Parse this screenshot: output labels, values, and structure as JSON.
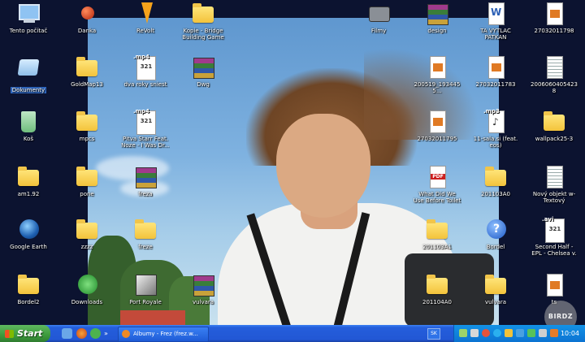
{
  "desktop": {
    "icons": [
      {
        "label": "Tento počítač",
        "type": "computer"
      },
      {
        "label": "Danka",
        "type": "ball"
      },
      {
        "label": "ReVolt",
        "type": "shortcut-bolt"
      },
      {
        "label": "Kopie - Bridge Building Game",
        "type": "folder"
      },
      {
        "label": "Filmy",
        "type": "camera"
      },
      {
        "label": "design",
        "type": "rar"
      },
      {
        "label": "TA VYTLAČ PATKAN",
        "type": "word"
      },
      {
        "label": "27032011798",
        "type": "image"
      },
      {
        "label": "Dokumenty",
        "type": "mydocs",
        "selected": true
      },
      {
        "label": "GoldMap13",
        "type": "folder"
      },
      {
        "label": "dva roky sniest",
        "type": "mp4",
        "tag": ".mp4"
      },
      {
        "label": "Dwg",
        "type": "rar"
      },
      {
        "label": "200519_1934455...",
        "type": "image"
      },
      {
        "label": "27032011783",
        "type": "image"
      },
      {
        "label": "20060604054238",
        "type": "image-lines"
      },
      {
        "label": "Koš",
        "type": "recycle"
      },
      {
        "label": "mpcs",
        "type": "folder"
      },
      {
        "label": "Pitva Starr Feat. Noze - I Was Dr...",
        "type": "mp4",
        "tag": ".mp4"
      },
      {
        "label": "27032011795",
        "type": "image"
      },
      {
        "label": "11-sala.si (feat. eos)",
        "type": "mp3",
        "tag": ".mp3"
      },
      {
        "label": "wallpack25-3",
        "type": "folder"
      },
      {
        "label": "am1.92",
        "type": "folder"
      },
      {
        "label": "pone",
        "type": "folder"
      },
      {
        "label": "freza",
        "type": "rar"
      },
      {
        "label": "What Did We Use Before Toilet Paper",
        "type": "pdf"
      },
      {
        "label": "201103A0",
        "type": "folder"
      },
      {
        "label": "Nový objekt w-Textový dokument",
        "type": "text"
      },
      {
        "label": "Google Earth",
        "type": "earth"
      },
      {
        "label": "zzzz",
        "type": "folder"
      },
      {
        "label": "freze",
        "type": "folder"
      },
      {
        "label": "201103A1",
        "type": "folder"
      },
      {
        "label": "Bordel",
        "type": "help"
      },
      {
        "label": "Second Half - EPL - Chelsea v. Man C...",
        "type": "avi",
        "tag": ".avi"
      },
      {
        "label": "Bordel2",
        "type": "folder"
      },
      {
        "label": "Downloads",
        "type": "download"
      },
      {
        "label": "Port Royale",
        "type": "game"
      },
      {
        "label": "vulvara",
        "type": "rar"
      },
      {
        "label": "201104A0",
        "type": "folder"
      },
      {
        "label": "vulvara",
        "type": "folder"
      },
      {
        "label": "ts",
        "type": "image"
      }
    ]
  },
  "taskbar": {
    "start_label": "Start",
    "active_task": "Albumy - Frez (frez.w...",
    "language": "SK",
    "clock": "10:04"
  },
  "watermark": "BIRDZ",
  "colors": {
    "taskbar_blue": "#245edb",
    "start_green": "#3c9a3c",
    "selection": "#316ac5"
  }
}
